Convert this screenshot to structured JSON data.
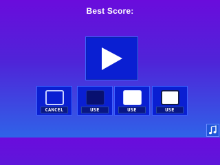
{
  "header": {
    "title": "Best Score:"
  },
  "play_button": {
    "icon": "play-icon"
  },
  "options": [
    {
      "label": "CANCEL",
      "swatch": "outline"
    },
    {
      "label": "USE",
      "swatch": "dark-navy"
    },
    {
      "label": "USE",
      "swatch": "white"
    },
    {
      "label": "USE",
      "swatch": "white-dark-border"
    }
  ],
  "music_button": {
    "icon": "music-note-icon"
  },
  "colors": {
    "background_top": "#6a0cdc",
    "background_bottom": "#2f63e8",
    "panel": "#0a1fd2",
    "panel_border": "#3c62ff"
  }
}
